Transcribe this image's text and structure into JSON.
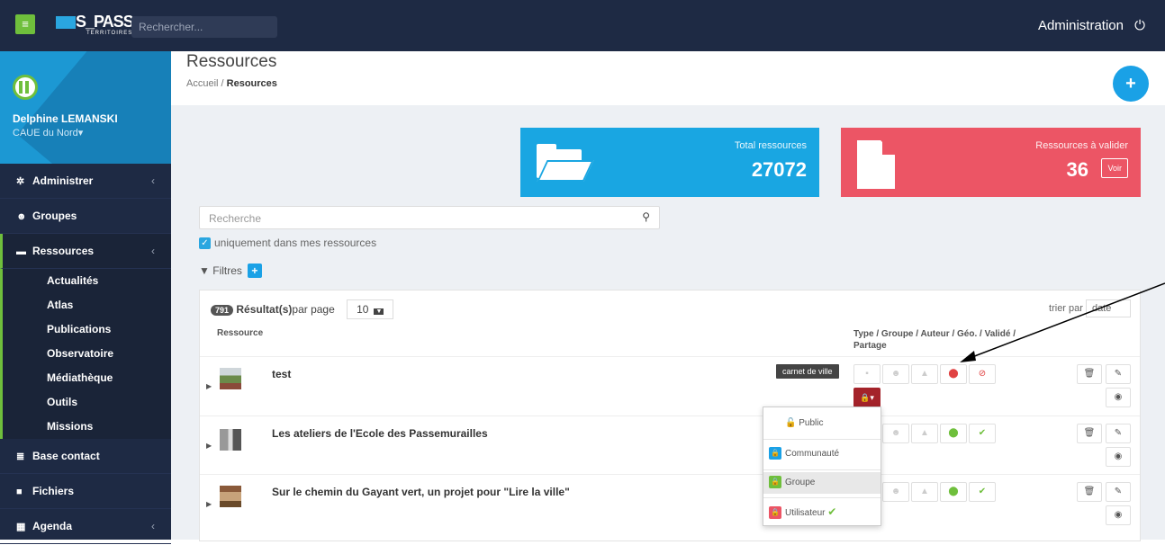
{
  "topbar": {
    "search_placeholder": "Rechercher...",
    "admin_label": "Administration",
    "logo_text": "S_PASS",
    "logo_sub": "TERRITOIRES"
  },
  "profile": {
    "name": "Delphine LEMANSKI",
    "org": "CAUE du Nord",
    "org_caret": "▾"
  },
  "sidebar": {
    "items": [
      {
        "label": "Administrer",
        "icon": "gear-icon"
      },
      {
        "label": "Groupes",
        "icon": "users-icon"
      },
      {
        "label": "Ressources",
        "icon": "folder-icon"
      },
      {
        "label": "Base contact",
        "icon": "database-icon"
      },
      {
        "label": "Fichiers",
        "icon": "file-icon"
      },
      {
        "label": "Agenda",
        "icon": "calendar-icon"
      }
    ],
    "sub_items": [
      "Actualités",
      "Atlas",
      "Publications",
      "Observatoire",
      "Médiathèque",
      "Outils",
      "Missions"
    ]
  },
  "header": {
    "title": "Ressources",
    "crumb_home": "Accueil",
    "crumb_sep": "/",
    "crumb_current": "Resources"
  },
  "stats": {
    "total_label": "Total ressources",
    "total_value": "27072",
    "pending_label": "Ressources à valider",
    "pending_value": "36",
    "voir_label": "Voir"
  },
  "search": {
    "placeholder": "Recherche"
  },
  "only_mine": "uniquement dans mes ressources",
  "filters_label": "Filtres",
  "results": {
    "count": "791",
    "label": "Résultat(s)",
    "per_page_label": "par page",
    "per_page_value": "10",
    "sort_label": "trier par",
    "sort_value": "date"
  },
  "columns": {
    "resource": "Ressource",
    "meta": "Type / Groupe / Auteur / Géo. / Validé / Partage"
  },
  "rows": [
    {
      "title": "test",
      "tag": "carnet de ville"
    },
    {
      "title": "Les ateliers de l'Ecole des Passemurailles",
      "tag": ""
    },
    {
      "title": "Sur le chemin du Gayant vert, un projet pour \"Lire la ville\"",
      "tag": ""
    }
  ],
  "share_menu": {
    "items": [
      "Public",
      "Communauté",
      "Groupe",
      "Utilisateur"
    ]
  },
  "colors": {
    "accent": "#1aa1e6",
    "green": "#6fbf3c",
    "red": "#ec5565",
    "dark": "#1e2a44"
  }
}
